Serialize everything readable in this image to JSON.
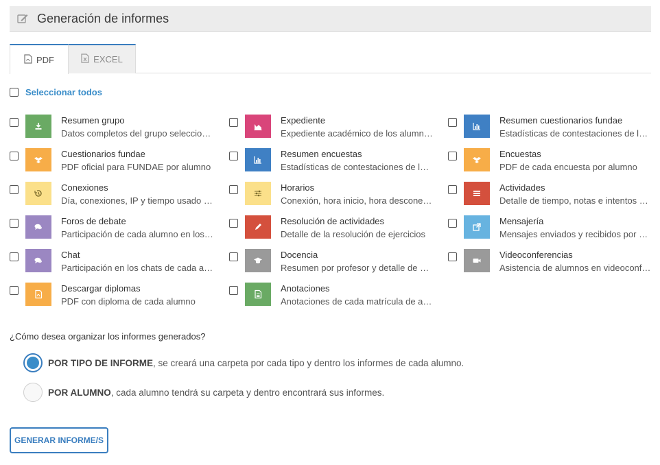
{
  "header": {
    "title": "Generación de informes",
    "icon": "edit-icon"
  },
  "tabs": [
    {
      "label": "PDF",
      "icon": "pdf-file-icon",
      "active": true
    },
    {
      "label": "EXCEL",
      "icon": "excel-file-icon",
      "active": false
    }
  ],
  "select_all": {
    "label": "Seleccionar todos",
    "checked": false
  },
  "reports": [
    {
      "title": "Resumen grupo",
      "desc": "Datos completos del grupo seleccionado",
      "color": "#6aaa64",
      "icon": "download-icon"
    },
    {
      "title": "Expediente",
      "desc": "Expediente académico de los alumnos",
      "color": "#d9457a",
      "icon": "area-chart-icon"
    },
    {
      "title": "Resumen cuestionarios fundae",
      "desc": "Estadísticas de contestaciones de los cuestionarios",
      "color": "#3f80c4",
      "icon": "bar-chart-icon"
    },
    {
      "title": "Cuestionarios fundae",
      "desc": "PDF oficial para FUNDAE por alumno",
      "color": "#f7ad48",
      "icon": "dropbox-icon"
    },
    {
      "title": "Resumen encuestas",
      "desc": "Estadísticas de contestaciones de las encuestas",
      "color": "#3f80c4",
      "icon": "bar-chart-icon"
    },
    {
      "title": "Encuestas",
      "desc": "PDF de cada encuesta por alumno",
      "color": "#f7ad48",
      "icon": "dropbox-icon"
    },
    {
      "title": "Conexiones",
      "desc": "Día, conexiones, IP y tiempo usado por alumno",
      "color": "#fbe08a",
      "icon": "history-icon"
    },
    {
      "title": "Horarios",
      "desc": "Conexión, hora inicio, hora desconexión",
      "color": "#fbe08a",
      "icon": "sliders-icon"
    },
    {
      "title": "Actividades",
      "desc": "Detalle de tiempo, notas e intentos por actividad",
      "color": "#d4503d",
      "icon": "list-icon"
    },
    {
      "title": "Foros de debate",
      "desc": "Participación de cada alumno en los foros",
      "color": "#9b87c2",
      "icon": "comments-icon"
    },
    {
      "title": "Resolución de actividades",
      "desc": "Detalle de la resolución de ejercicios",
      "color": "#d4503d",
      "icon": "pencil-icon"
    },
    {
      "title": "Mensajería",
      "desc": "Mensajes enviados y recibidos por alumno",
      "color": "#67b3e0",
      "icon": "external-link-icon"
    },
    {
      "title": "Chat",
      "desc": "Participación en los chats de cada alumno",
      "color": "#9b87c2",
      "icon": "comments-icon"
    },
    {
      "title": "Docencia",
      "desc": "Resumen por profesor y detalle de actividad",
      "color": "#9a9a9a",
      "icon": "graduation-cap-icon"
    },
    {
      "title": "Videoconferencias",
      "desc": "Asistencia de alumnos en videoconferencias",
      "color": "#9a9a9a",
      "icon": "video-camera-icon"
    },
    {
      "title": "Descargar diplomas",
      "desc": "PDF con diploma de cada alumno",
      "color": "#f7ad48",
      "icon": "pdf-file-icon"
    },
    {
      "title": "Anotaciones",
      "desc": "Anotaciones de cada matrícula de alumno",
      "color": "#6aaa64",
      "icon": "document-icon"
    }
  ],
  "organize": {
    "question": "¿Cómo desea organizar los informes generados?",
    "options": [
      {
        "bold": "POR TIPO DE INFORME",
        "rest": ", se creará una carpeta por cada tipo y dentro los informes de cada alumno.",
        "selected": true
      },
      {
        "bold": "POR ALUMNO",
        "rest": ", cada alumno tendrá su carpeta y dentro encontrará sus informes.",
        "selected": false
      }
    ]
  },
  "generate_button": {
    "label": "GENERAR INFORME/S"
  }
}
